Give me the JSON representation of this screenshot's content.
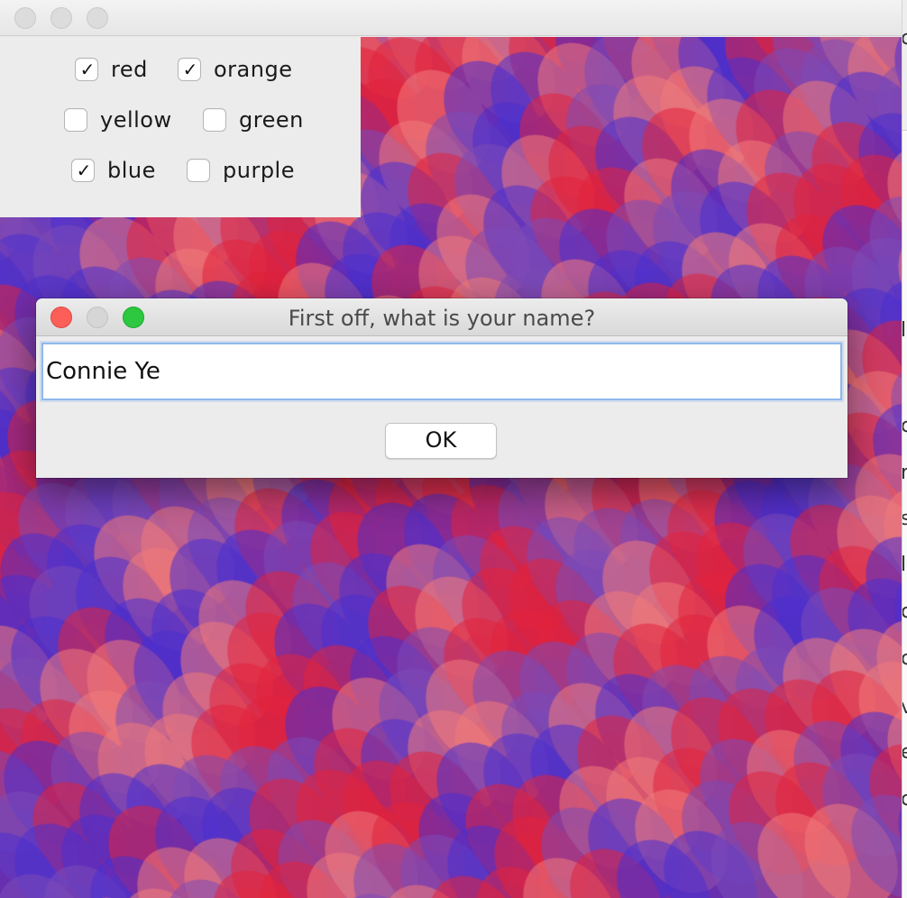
{
  "main_window": {
    "colors": {
      "pattern_primary": "#e2233c",
      "pattern_secondary": "#4a2fd0",
      "pattern_pink": "#f07a7a",
      "pattern_violet": "#7b4bb8"
    },
    "color_options": [
      {
        "label": "red",
        "checked": true
      },
      {
        "label": "orange",
        "checked": true
      },
      {
        "label": "yellow",
        "checked": false
      },
      {
        "label": "green",
        "checked": false
      },
      {
        "label": "blue",
        "checked": true
      },
      {
        "label": "purple",
        "checked": false
      }
    ]
  },
  "dialog": {
    "title": "First off, what is your name?",
    "name_value": "Connie Ye",
    "ok_label": "OK"
  },
  "background_window": {
    "edge_glyphs": [
      "c",
      "l",
      "c",
      "r",
      "s",
      "l",
      "c",
      "c",
      "v",
      "e",
      "c"
    ]
  },
  "check_glyph": "✓"
}
